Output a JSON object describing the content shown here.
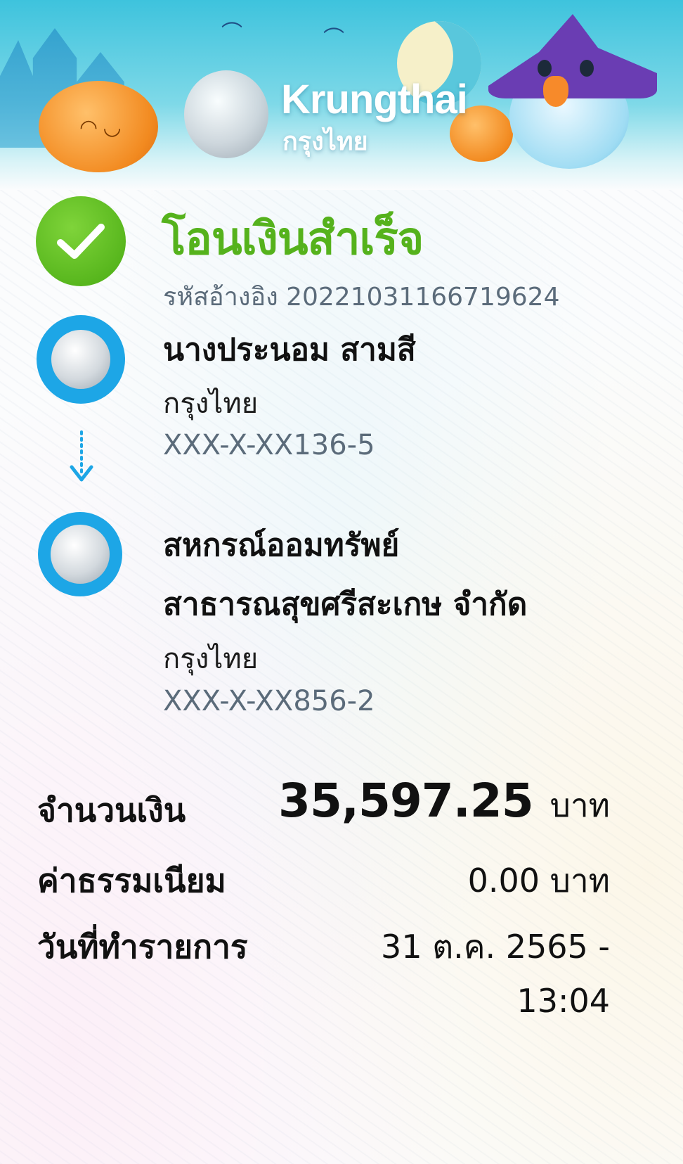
{
  "header": {
    "brand_name": "Krungthai",
    "brand_name_thai": "กรุงไทย"
  },
  "status": {
    "title": "โอนเงินสำเร็จ",
    "reference": "รหัสอ้างอิง 20221031166719624"
  },
  "sender": {
    "name": "นางประนอม สามสี",
    "bank": "กรุงไทย",
    "account": "XXX-X-XX136-5"
  },
  "receiver": {
    "name_line1": "สหกรณ์ออมทรัพย์",
    "name_line2": "สาธารณสุขศรีสะเกษ จำกัด",
    "bank": "กรุงไทย",
    "account": "XXX-X-XX856-2"
  },
  "details": {
    "amount_label": "จำนวนเงิน",
    "amount_value": "35,597.25",
    "amount_unit": "บาท",
    "fee_label": "ค่าธรรมเนียม",
    "fee_value": "0.00 บาท",
    "date_label": "วันที่ทำรายการ",
    "date_value": "31 ต.ค. 2565 -",
    "time_value": "13:04"
  },
  "colors": {
    "success_green": "#55b21c",
    "bank_blue": "#1da6e6",
    "muted_text": "#5b6b7a"
  },
  "icons": {
    "status": "check-icon",
    "bank": "krungthai-logo-icon",
    "transfer_direction": "arrow-down-icon"
  }
}
